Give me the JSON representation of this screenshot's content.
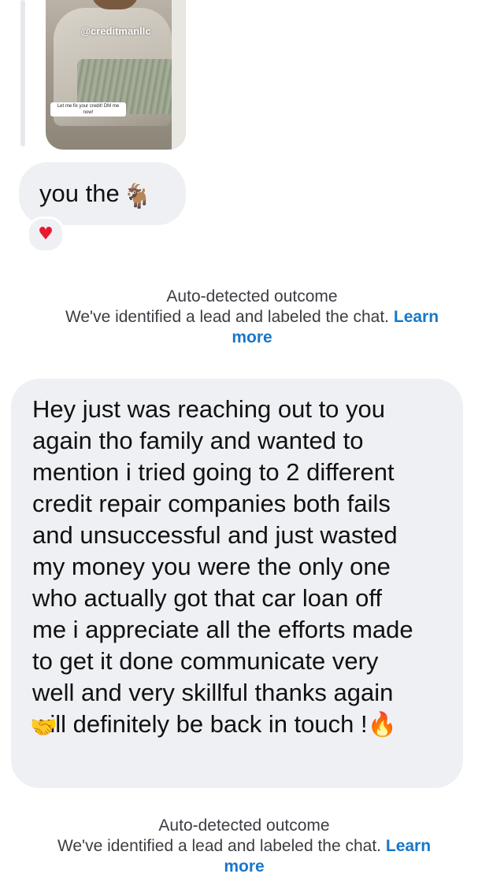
{
  "shared_post": {
    "handle": "@creditmanllc",
    "caption": "Let me fix your credit! DM me now!"
  },
  "messages": {
    "short": {
      "text": "you the",
      "emoji": "goat-icon",
      "reaction": "♥"
    },
    "long": {
      "text": "Hey just was reaching out to you\nagain tho family and wanted to\nmention i tried going to 2 different\ncredit repair companies both fails\nand unsuccessful and just wasted\nmy money you were the only one\nwho actually got that car loan off\nme i appreciate all the efforts made\nto get it done communicate very\nwell  and very skillful thanks again\nwill definitely be back in touch !",
      "trailing_emoji": "🔥",
      "handshake_emoji": "🤝"
    }
  },
  "system_notes": [
    {
      "title": "Auto-detected outcome",
      "body": "We've identified a lead and labeled the chat.",
      "link_start": "Learn",
      "link_end": "more"
    },
    {
      "title": "Auto-detected outcome",
      "body": "We've identified a lead and labeled the chat.",
      "link_start": "Learn",
      "link_end": "more"
    }
  ],
  "colors": {
    "bubble": "#eff0f4",
    "link": "#1877c9",
    "reaction": "#e8192c"
  }
}
